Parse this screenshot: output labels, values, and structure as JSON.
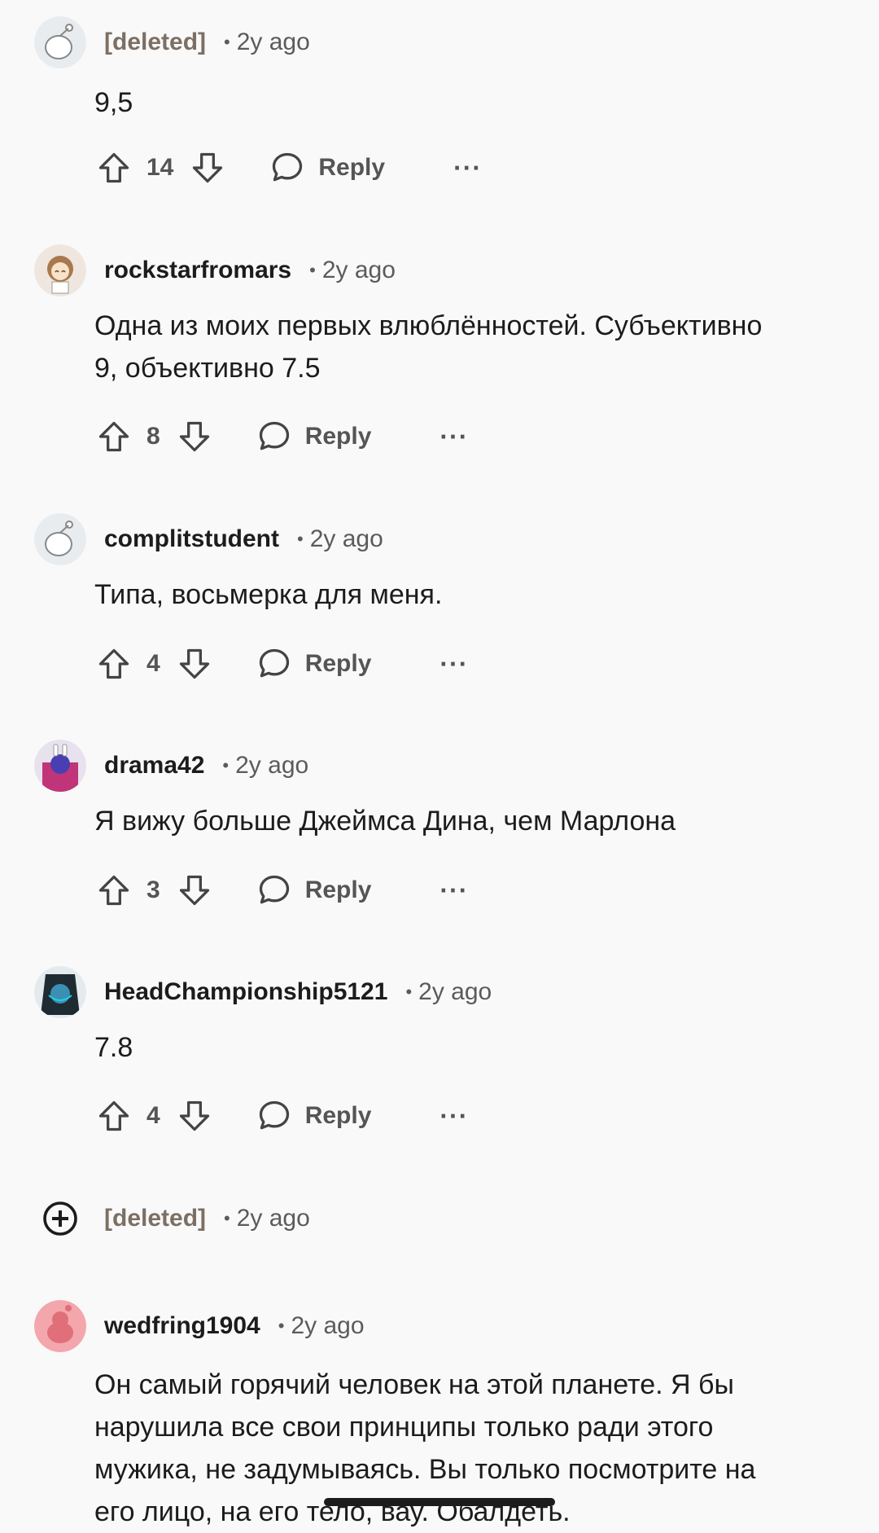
{
  "comments": [
    {
      "user": "[deleted]",
      "time": "2y ago",
      "dot": "•",
      "text": "9,5",
      "score": "14",
      "reply": "Reply",
      "more": "···"
    },
    {
      "user": "rockstarfromars",
      "time": "2y ago",
      "dot": "•",
      "text_lines": [
        "Одна из моих первых влюблённостей. Субъективно",
        "9, объективно 7.5"
      ],
      "score": "8",
      "reply": "Reply",
      "more": "···"
    },
    {
      "user": "complitstudent",
      "time": "2y ago",
      "dot": "•",
      "text": "Типа, восьмерка для меня.",
      "score": "4",
      "reply": "Reply",
      "more": "···"
    },
    {
      "user": "drama42",
      "time": "2y ago",
      "dot": "•",
      "text": "Я вижу больше Джеймса Дина, чем Марлона",
      "score": "3",
      "reply": "Reply",
      "more": "···"
    },
    {
      "user": "HeadChampionship5121",
      "time": "2y ago",
      "dot": "•",
      "text": "7.8",
      "score": "4",
      "reply": "Reply",
      "more": "···"
    },
    {
      "user": "[deleted]",
      "time": "2y ago",
      "dot": "•",
      "collapsed": true
    },
    {
      "user": "wedfring1904",
      "time": "2y ago",
      "dot": "•",
      "text_lines": [
        "Он самый горячий человек на этой планете. Я бы",
        "нарушила все свои принципы только ради этого",
        "мужика, не задумываясь. Вы только посмотрите на",
        "его лицо, на его тело, вау. Обалдеть."
      ]
    }
  ],
  "icons": {
    "upvote": "upvote-icon",
    "downvote": "downvote-icon",
    "reply": "comment-bubble-icon",
    "more": "more-options-icon",
    "expand": "expand-plus-icon",
    "avatar": "snoo-avatar-icon"
  },
  "colors": {
    "avatar_pink": "#f3a6ac",
    "text": "#1c1c1c",
    "muted": "#5b5b5b",
    "deleted": "#7c6f64"
  }
}
